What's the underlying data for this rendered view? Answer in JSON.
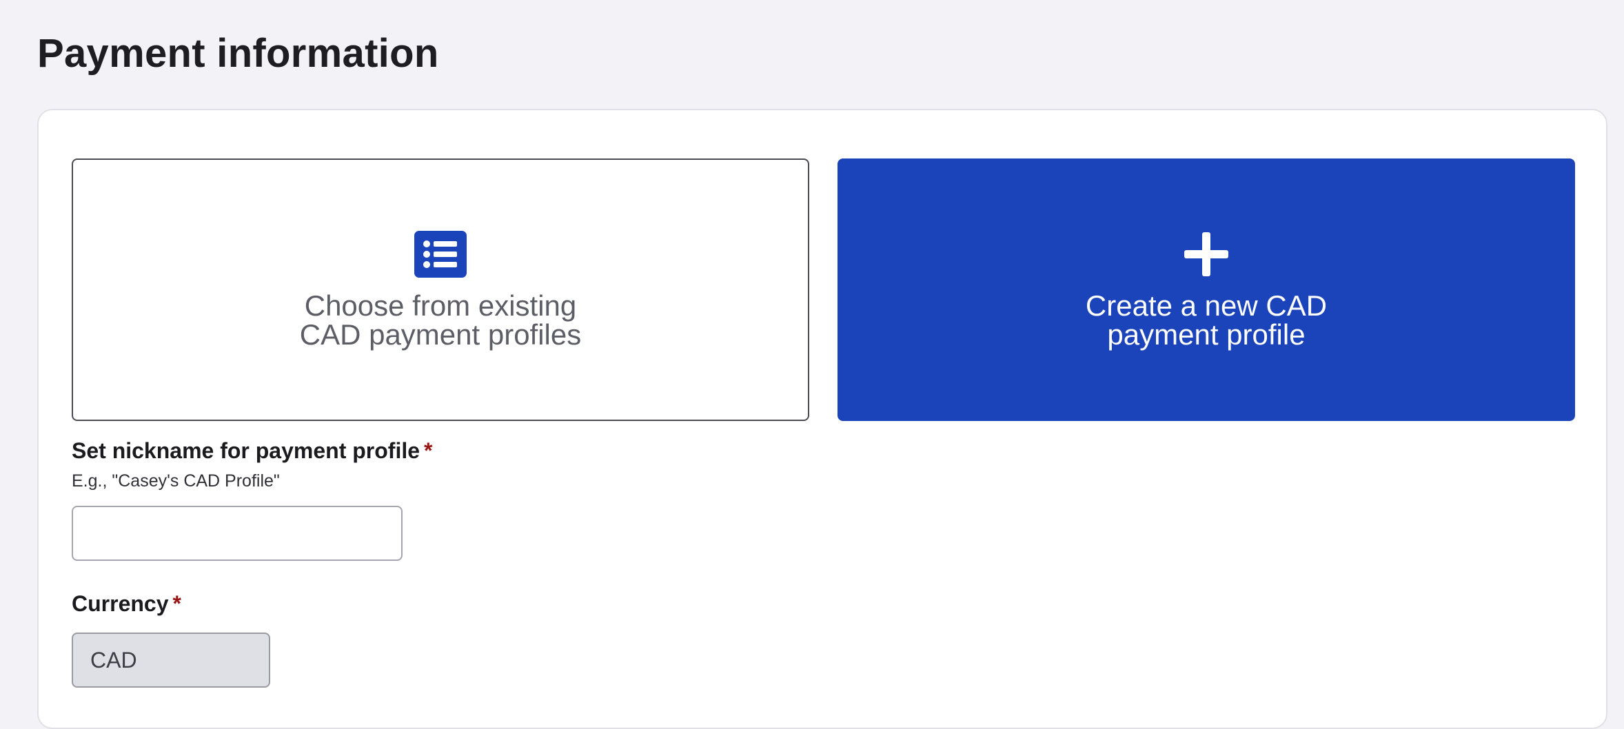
{
  "page": {
    "title": "Payment information"
  },
  "profile_options": {
    "existing": {
      "label_line1": "Choose from existing",
      "label_line2": "CAD payment profiles",
      "icon": "list-icon"
    },
    "create": {
      "label_line1": "Create a new CAD",
      "label_line2": "payment profile",
      "icon": "plus-icon",
      "selected": true
    }
  },
  "form": {
    "nickname": {
      "label": "Set nickname for payment profile",
      "required_mark": "*",
      "hint": "E.g., \"Casey's CAD Profile\"",
      "value": "",
      "placeholder": ""
    },
    "currency": {
      "label": "Currency",
      "required_mark": "*",
      "value": "CAD",
      "disabled": true
    }
  },
  "colors": {
    "accent": "#1b44bb",
    "required": "#9c1313",
    "background": "#f3f3f7"
  }
}
